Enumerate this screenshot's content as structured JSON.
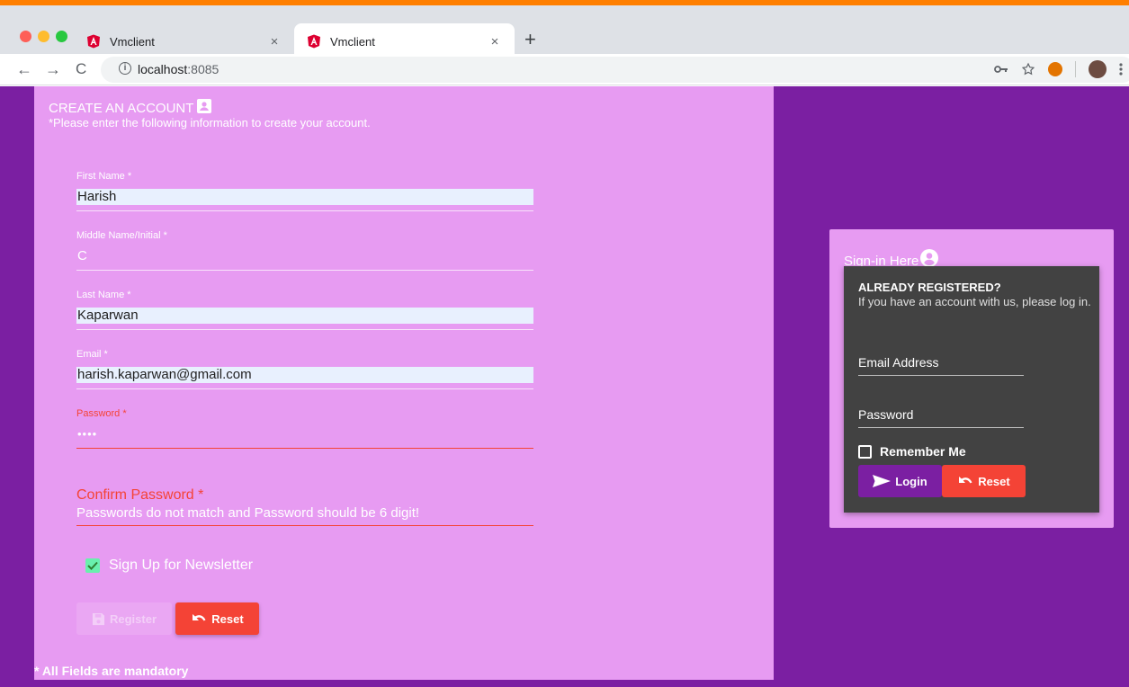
{
  "browser": {
    "tabs": [
      {
        "title": "Vmclient",
        "close": "×",
        "active": false
      },
      {
        "title": "Vmclient",
        "close": "×",
        "active": true
      }
    ],
    "new_tab": "+",
    "nav": {
      "back": "←",
      "forward": "→",
      "reload": "C"
    },
    "url_host": "localhost",
    "url_port": ":8085"
  },
  "register": {
    "title": "CREATE AN ACCOUNT",
    "subtitle": "*Please enter the following information to create your account.",
    "fields": [
      {
        "label": "First Name *",
        "value": "Harish"
      },
      {
        "label": "Middle Name/Initial *",
        "value": "C"
      },
      {
        "label": "Last Name *",
        "value": "Kaparwan"
      },
      {
        "label": "Email *",
        "value": "harish.kaparwan@gmail.com"
      },
      {
        "label": "Password *",
        "value": "••••"
      }
    ],
    "confirm_label": "Confirm Password *",
    "confirm_error": "Passwords do not match and Password should be 6 digit!",
    "newsletter_label": "Sign Up for Newsletter",
    "newsletter_checked": true,
    "register_button": "Register",
    "reset_button": "Reset",
    "mandatory_note": "* All Fields are mandatory"
  },
  "signin": {
    "title": "Sign-in Here",
    "heading": "ALREADY REGISTERED?",
    "description": "If you have an account with us, please log in.",
    "email_placeholder": "Email Address",
    "password_placeholder": "Password",
    "remember_label": "Remember Me",
    "login_button": "Login",
    "reset_button": "Reset"
  },
  "colors": {
    "page_background": "#7b1fa2",
    "panel": "#e79bf2",
    "login_box": "#424242",
    "error": "#f44336",
    "reset_button": "#f44336",
    "login_button": "#7b1fa2",
    "checkbox_checked": "#69f0ae",
    "browser_accent": "#ff7f00"
  }
}
